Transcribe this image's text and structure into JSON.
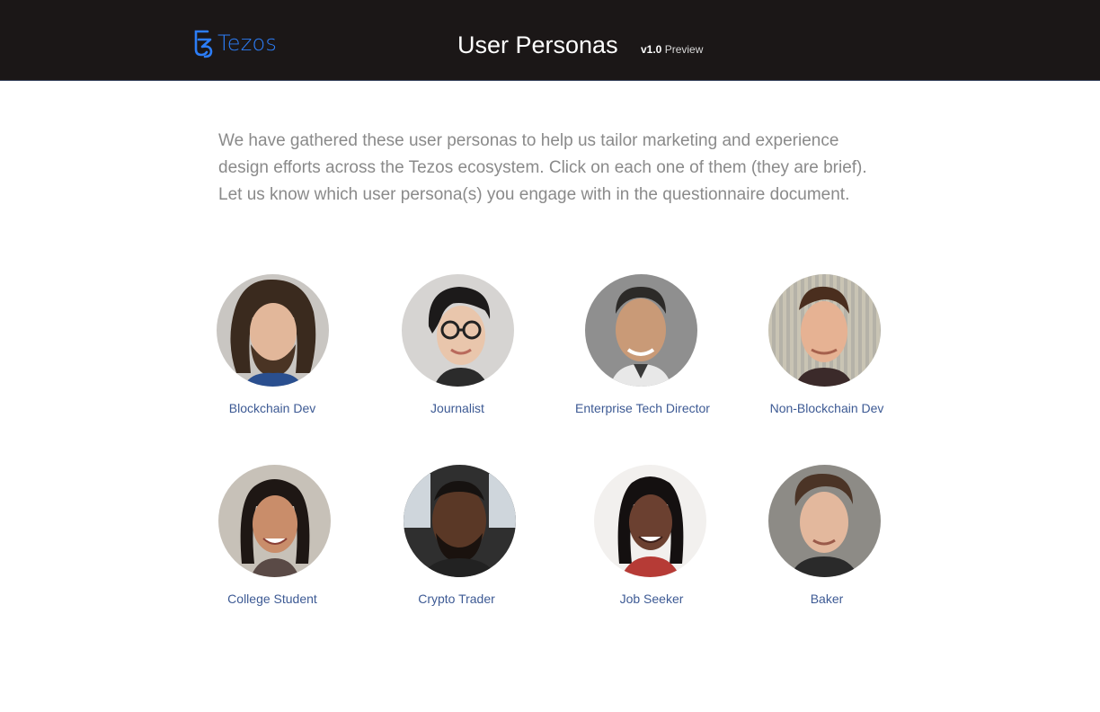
{
  "header": {
    "logo_text": "Tezos",
    "title": "User Personas",
    "version": "v1.0",
    "version_tag": "Preview"
  },
  "intro": {
    "text": "We have gathered these user personas to help us tailor marketing and experience design efforts across the Tezos ecosystem. Click on each one of them (they are brief). Let us know which user persona(s) you engage with in the questionnaire document."
  },
  "personas": [
    {
      "label": "Blockchain Dev"
    },
    {
      "label": "Journalist"
    },
    {
      "label": "Enterprise Tech Director"
    },
    {
      "label": "Non-Blockchain Dev"
    },
    {
      "label": "College Student"
    },
    {
      "label": "Crypto Trader"
    },
    {
      "label": "Job Seeker"
    },
    {
      "label": "Baker"
    }
  ],
  "colors": {
    "header_bg": "#1b1717",
    "logo_blue": "#2c7df7",
    "label_blue": "#3d5a94",
    "intro_gray": "#8a8a8a"
  }
}
